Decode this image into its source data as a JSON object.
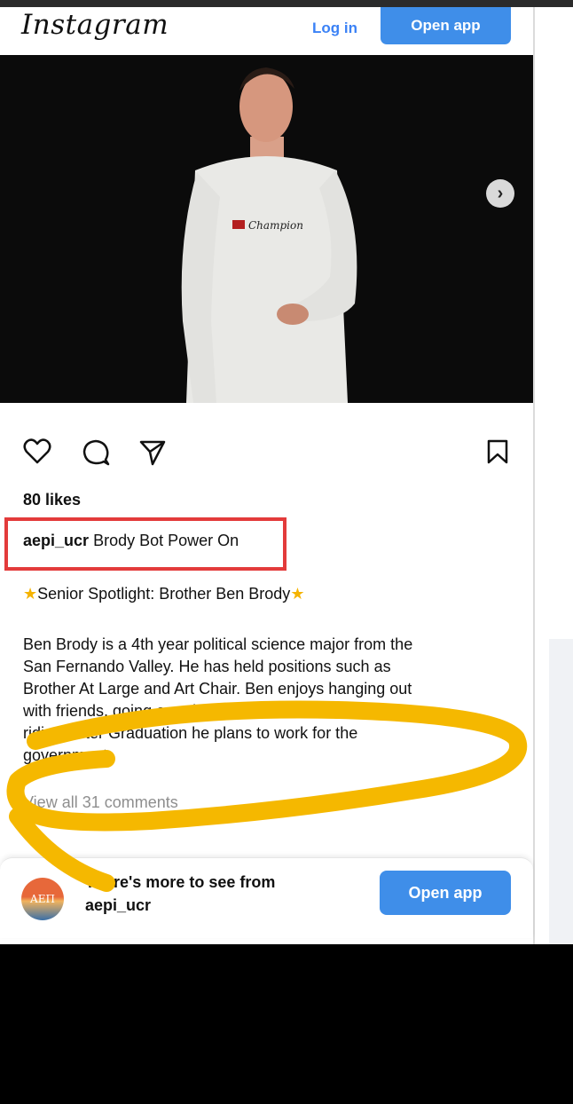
{
  "header": {
    "logo": "Instagram",
    "login_label": "Log in",
    "open_app_label": "Open app"
  },
  "photo": {
    "shirt_text": "Champion",
    "next_icon": "chevron-right-icon",
    "carousel_total": 3,
    "carousel_active": 1
  },
  "actions": {
    "icons": [
      "heart-icon",
      "comment-icon",
      "share-icon",
      "bookmark-icon"
    ]
  },
  "post": {
    "likes": "80 likes",
    "username": "aepi_ucr",
    "caption": "Brody Bot Power On",
    "spotlight": "Senior Spotlight: Brother Ben Brody",
    "body_lines": [
      "Ben Brody is a 4th year political science major from the",
      "San Fernando Valley. He has held positions such as",
      "Brother At Large and Art Chair. Ben enjoys hanging out",
      "with friends, going on adventures and mountain bike",
      "riding. After Graduation he plans to work for the",
      "government."
    ],
    "view_comments": "View all 31 comments"
  },
  "more_bar": {
    "avatar_text": "ΑΕΠ",
    "line1": "There's more to see from",
    "line2": "aepi_ucr",
    "open_app_label": "Open app"
  },
  "colors": {
    "accent_blue": "#3f8ee9",
    "highlight_red": "#e33b3b",
    "scribble_yellow": "#f5b800"
  }
}
